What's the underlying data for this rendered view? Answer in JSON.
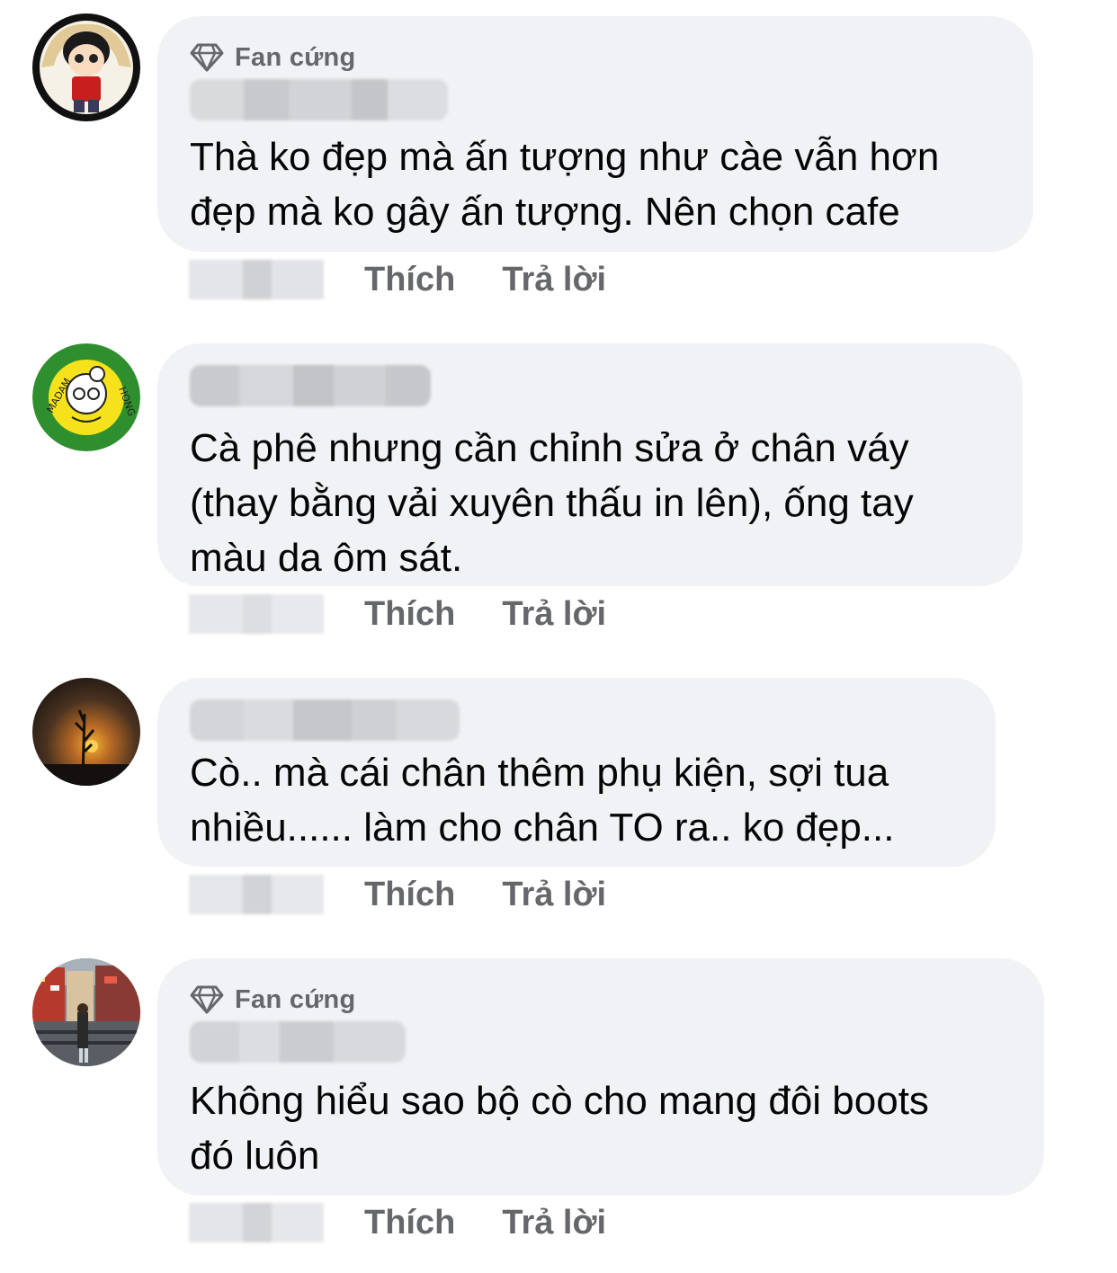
{
  "comments": [
    {
      "avatar": "avatar-cartoon-boy",
      "badge": "Fan cứng",
      "badge_icon": "diamond-icon",
      "text": "Thà ko đẹp mà ấn tượng như càe vẫn hơn\nđẹp mà ko gây ấn tượng. Nên chọn cafe",
      "like_label": "Thích",
      "reply_label": "Trả lời"
    },
    {
      "avatar": "avatar-madam-hong-logo",
      "text": "Cà phê nhưng cần chỉnh sửa ở chân váy\n(thay bằng vải xuyên thấu in lên), ống tay\nmàu da ôm sát.",
      "like_label": "Thích",
      "reply_label": "Trả lời"
    },
    {
      "avatar": "avatar-sunset-photo",
      "text": "Cò.. mà cái chân thêm phụ kiện, sợi tua\nnhiều...... làm cho chân TO ra.. ko đẹp...",
      "like_label": "Thích",
      "reply_label": "Trả lời"
    },
    {
      "avatar": "avatar-city-street-photo",
      "badge": "Fan cứng",
      "badge_icon": "diamond-icon",
      "text": "Không hiểu sao bộ cò cho mang đôi boots\nđó luôn",
      "like_label": "Thích",
      "reply_label": "Trả lời"
    }
  ],
  "colors": {
    "bubble": "#f0f2f5",
    "secondary_text": "#65676b",
    "primary_text": "#050505"
  }
}
